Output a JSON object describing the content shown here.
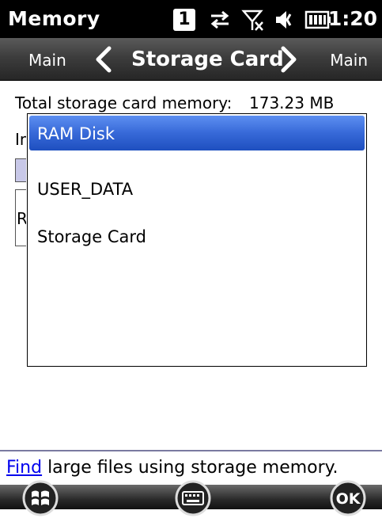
{
  "status": {
    "app_title": "Memory",
    "badge": "1",
    "time": "1:20"
  },
  "pivot": {
    "left": "Main",
    "center": "Storage Card",
    "right": "Main"
  },
  "background": {
    "total_label": "Total storage card memory:",
    "total_value": "173.23 MB",
    "partial_label_1": "In",
    "partial_label_2": "R"
  },
  "dropdown": {
    "options": [
      "RAM Disk",
      "USER_DATA",
      "Storage Card"
    ],
    "selected": "RAM Disk"
  },
  "footer": {
    "link": "Find",
    "text": " large files using storage memory."
  },
  "softkeys": {
    "ok_label": "OK"
  }
}
